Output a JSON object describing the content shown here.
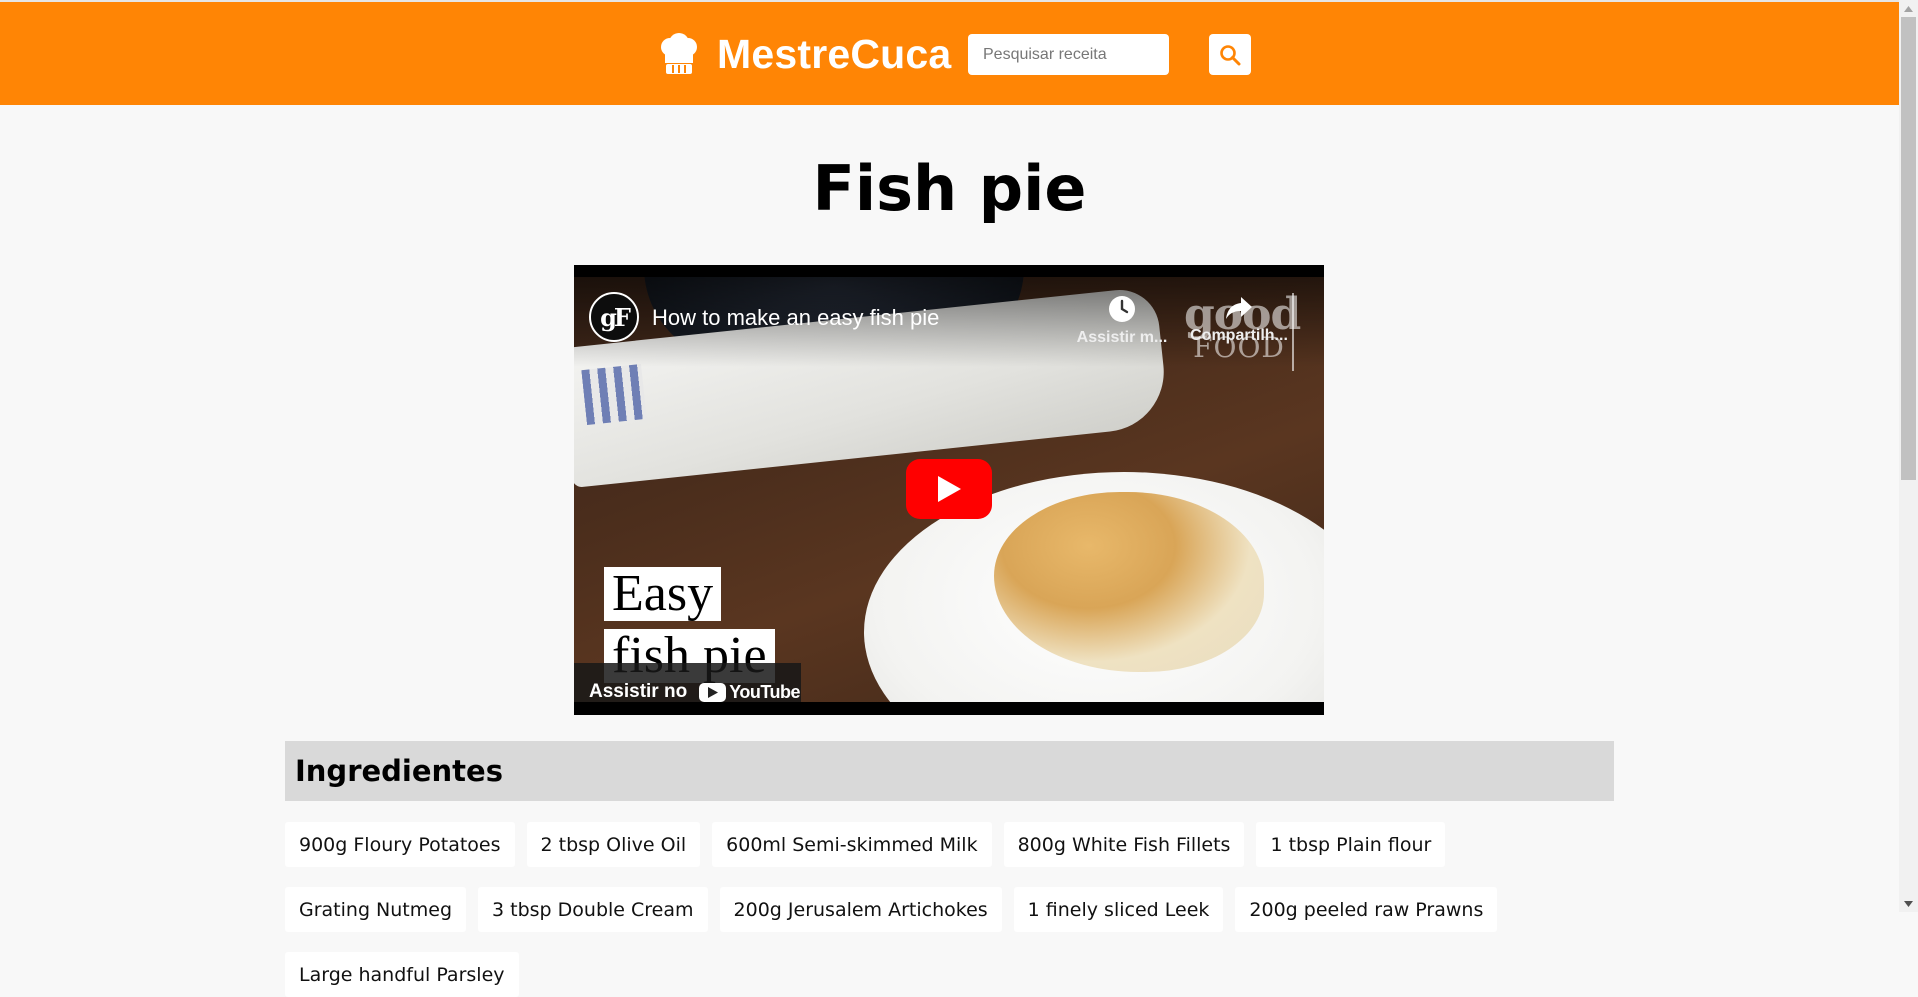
{
  "header": {
    "brand": "MestreCuca",
    "brand_icon": "chef-hat-icon",
    "search": {
      "placeholder": "Pesquisar receita",
      "value": ""
    },
    "search_button_icon": "search-icon",
    "accent_color": "#ff8505"
  },
  "recipe": {
    "title": "Fish pie"
  },
  "video": {
    "channel_avatar_text": "gF",
    "title": "How to make an easy fish pie",
    "watch_later_label": "Assistir m...",
    "share_label": "Compartilh...",
    "brand_watermark_line1": "good",
    "brand_watermark_line2": "FOOD",
    "thumbnail_text_line1": "Easy",
    "thumbnail_text_line2": "fish pie",
    "watch_on_label": "Assistir no",
    "youtube_label": "YouTube",
    "play_button_color": "#ff0000"
  },
  "ingredients": {
    "heading": "Ingredientes",
    "items": [
      "900g Floury Potatoes",
      "2 tbsp Olive Oil",
      "600ml Semi-skimmed Milk",
      "800g White Fish Fillets",
      "1 tbsp Plain flour",
      "Grating Nutmeg",
      "3 tbsp Double Cream",
      "200g Jerusalem Artichokes",
      "1 finely sliced Leek",
      "200g peeled raw Prawns",
      "Large handful Parsley"
    ]
  }
}
